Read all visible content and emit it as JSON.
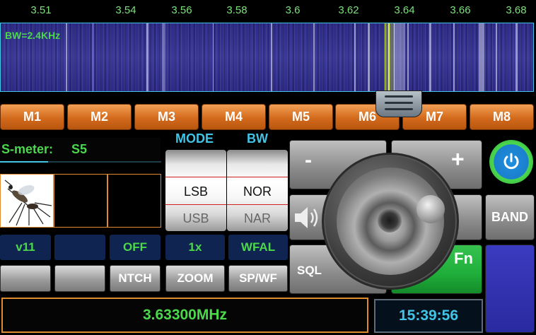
{
  "scale": {
    "ticks": [
      "3.51",
      "3.54",
      "3.56",
      "3.58",
      "3.6",
      "3.62",
      "3.64",
      "3.66",
      "3.68"
    ]
  },
  "waterfall": {
    "bandwidth_label": "BW=2.4KHz"
  },
  "memory_buttons": [
    "M1",
    "M2",
    "M3",
    "M4",
    "M5",
    "M6",
    "M7",
    "M8"
  ],
  "smeter": {
    "label": "S-meter:",
    "value": "S5"
  },
  "mode": {
    "header": "MODE",
    "options": [
      "LSB",
      "USB"
    ],
    "selected": "LSB"
  },
  "bw": {
    "header": "BW",
    "options": [
      "NOR",
      "NAR"
    ],
    "selected": "NOR"
  },
  "status_row": {
    "version": "v11",
    "blank": "",
    "notch_state": "OFF",
    "zoom_state": "1x",
    "display_mode": "WFAL"
  },
  "buttons_row": {
    "notch": "NTCH",
    "zoom": "ZOOM",
    "spwf": "SP/WF"
  },
  "control_pad": {
    "minus": "-",
    "plus": "+",
    "squelch": "SQL",
    "function": "Fn",
    "band": "BAND"
  },
  "frequency": "3.63300MHz",
  "clock": "15:39:56",
  "colors": {
    "accent_green": "#4bd84b",
    "accent_cyan": "#41c4e6",
    "memory_orange": "#d36a1c",
    "fn_green": "#1fae3a",
    "band_blue": "#3535b5"
  }
}
